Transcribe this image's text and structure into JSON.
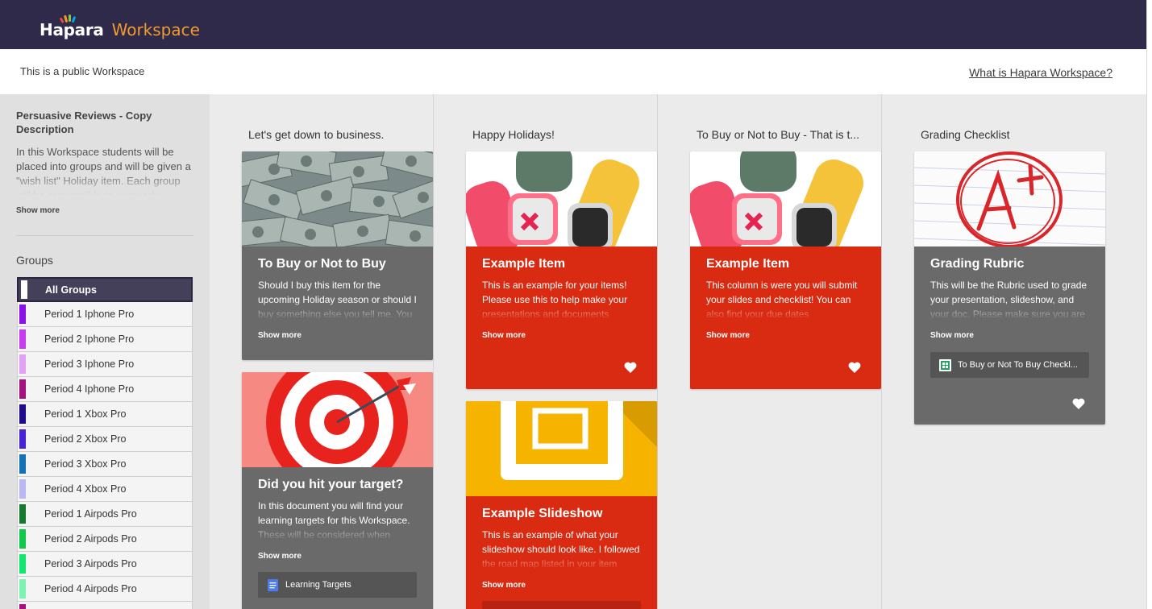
{
  "header": {
    "brand": "Hapara",
    "product": "Workspace",
    "public_notice": "This is a public Workspace",
    "what_link": "What is Hapara Workspace?"
  },
  "sidebar": {
    "title": "Persuasive Reviews - Copy",
    "desc_heading": "Description",
    "description": "In this Workspace students will be placed into groups and will be given a \"wish list\" Holiday  item. Each group will be responsible to persuade...",
    "show_more": "Show more",
    "groups_heading": "Groups",
    "groups": [
      {
        "label": "All Groups",
        "color": "#ffffff"
      },
      {
        "label": "Period 1 Iphone Pro",
        "color": "#8b12e6"
      },
      {
        "label": "Period 2 Iphone Pro",
        "color": "#c53dee"
      },
      {
        "label": "Period 3 Iphone Pro",
        "color": "#e1a2f5"
      },
      {
        "label": "Period 4 Iphone Pro",
        "color": "#a5117f"
      },
      {
        "label": "Period 1 Xbox Pro",
        "color": "#210b8c"
      },
      {
        "label": "Period 2 Xbox Pro",
        "color": "#4524d8"
      },
      {
        "label": "Period 3 Xbox Pro",
        "color": "#1272b3"
      },
      {
        "label": "Period 4 Xbox Pro",
        "color": "#b9b8f3"
      },
      {
        "label": "Period 1 Airpods Pro",
        "color": "#157a30"
      },
      {
        "label": "Period 2 Airpods Pro",
        "color": "#11c84a"
      },
      {
        "label": "Period 3 Airpods Pro",
        "color": "#13e670"
      },
      {
        "label": "Period 4 Airpods Pro",
        "color": "#7df3b3"
      }
    ]
  },
  "columns": [
    {
      "title": "Let's get down to business.",
      "cards": [
        {
          "title": "To Buy or Not to Buy",
          "body": "Should I buy this item for the upcoming Holiday season or should I buy something else you tell me. You tell me! You will need",
          "more": "Show more"
        },
        {
          "title": "Did you hit your target?",
          "body": "In this document you will find your learning targets for this Workspace. These will be considered when deciding your",
          "more": "Show more",
          "attachment": "Learning Targets"
        }
      ]
    },
    {
      "title": "Happy Holidays!",
      "cards": [
        {
          "title": "Example Item",
          "body": "This is an example for your items! Please use this to help make your presentations and documents presentation!",
          "more": "Show more"
        },
        {
          "title": "Example Slideshow",
          "body": "This is an example of what your slideshow should look like. I followed the road map listed in your item details also located in",
          "more": "Show more"
        }
      ]
    },
    {
      "title": "To Buy or Not to Buy - That is t...",
      "cards": [
        {
          "title": "Example Item",
          "body": "This column is were you will submit your slides and checklist!  You can also find your due dates",
          "more": "Show more"
        }
      ]
    },
    {
      "title": "Grading Checklist",
      "cards": [
        {
          "title": "Grading Rubric",
          "body": "This will be the Rubric used to grade your presentation, slideshow, and your doc. Please make sure you are familiar with it",
          "more": "Show more",
          "attachment": "To Buy or Not To Buy Checkl..."
        }
      ]
    }
  ],
  "colors": {
    "header_bg": "#302a4a",
    "brand_accent": "#f19b2c",
    "card_red": "#d92a12",
    "card_grey": "#6a6a6a"
  },
  "icons": [
    "hapara-logo-mark",
    "heart-icon",
    "google-docs-icon",
    "google-sheets-icon"
  ]
}
